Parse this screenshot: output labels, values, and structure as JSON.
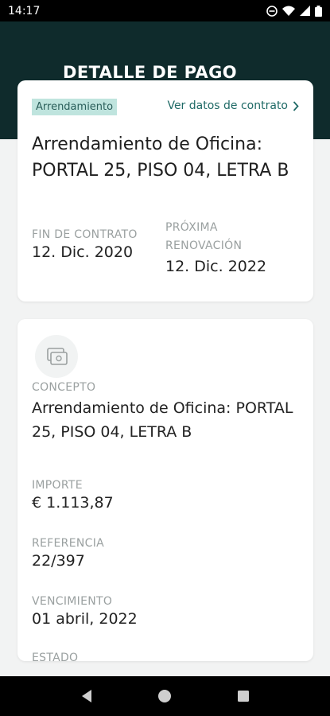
{
  "status_bar": {
    "time": "14:17"
  },
  "header": {
    "title": "DETALLE DE PAGO"
  },
  "contract_card": {
    "tag": "Arrendamiento",
    "link": "Ver datos de contrato",
    "title": "Arrendamiento de Oficina: PORTAL 25, PISO 04, LETRA B",
    "end_label": "FIN DE CONTRATO",
    "end_value": "12. Dic. 2020",
    "renewal_label": "PRÓXIMA RENOVACIÓN",
    "renewal_value": "12. Dic. 2022"
  },
  "detail_card": {
    "icon": "payment-document-icon",
    "fields": [
      {
        "label": "CONCEPTO",
        "value": "Arrendamiento de Oficina: PORTAL 25, PISO 04, LETRA B"
      },
      {
        "label": "IMPORTE",
        "value": "€ 1.113,87"
      },
      {
        "label": "REFERENCIA",
        "value": "22/397"
      },
      {
        "label": "VENCIMIENTO",
        "value": "01 abril, 2022"
      },
      {
        "label": "ESTADO",
        "value": ""
      }
    ]
  },
  "colors": {
    "header_bg": "#0f2b2c",
    "accent": "#1f6a66",
    "tag_bg": "#bfe4de"
  }
}
